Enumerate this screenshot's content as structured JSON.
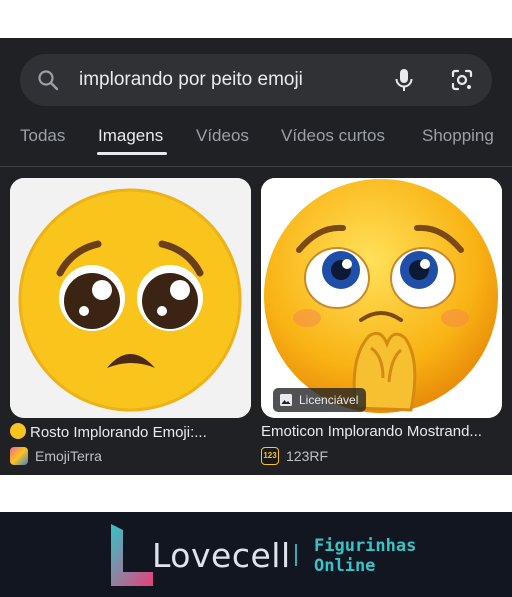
{
  "search": {
    "query": "implorando por peito emoji"
  },
  "tabs": [
    {
      "label": "Todas"
    },
    {
      "label": "Imagens"
    },
    {
      "label": "Vídeos"
    },
    {
      "label": "Vídeos curtos"
    },
    {
      "label": "Shopping"
    }
  ],
  "active_tab": "Imagens",
  "results": [
    {
      "title": "Rosto Implorando Emoji:...",
      "source": "EmojiTerra",
      "licensed": false
    },
    {
      "title": "Emoticon Implorando Mostrand...",
      "source": "123RF",
      "licensed": true,
      "badge_label": "Licenciável"
    }
  ],
  "banner": {
    "brand": "Lovecell",
    "tagline_line1": "Figurinhas",
    "tagline_line2": "Online"
  },
  "colors": {
    "background": "#202124",
    "search_bg": "#303134",
    "text_primary": "#e8eaed",
    "text_secondary": "#9aa0a6",
    "emoji_yellow": "#f9c41c",
    "banner_bg": "#121620",
    "brand_accent_teal": "#35c4c8",
    "brand_accent_pink": "#e8407a"
  },
  "icons": [
    "search-icon",
    "microphone-icon",
    "google-lens-icon",
    "image-icon",
    "pleading-face-emoji-icon",
    "123rf-logo-icon",
    "emojiterra-logo-icon"
  ]
}
